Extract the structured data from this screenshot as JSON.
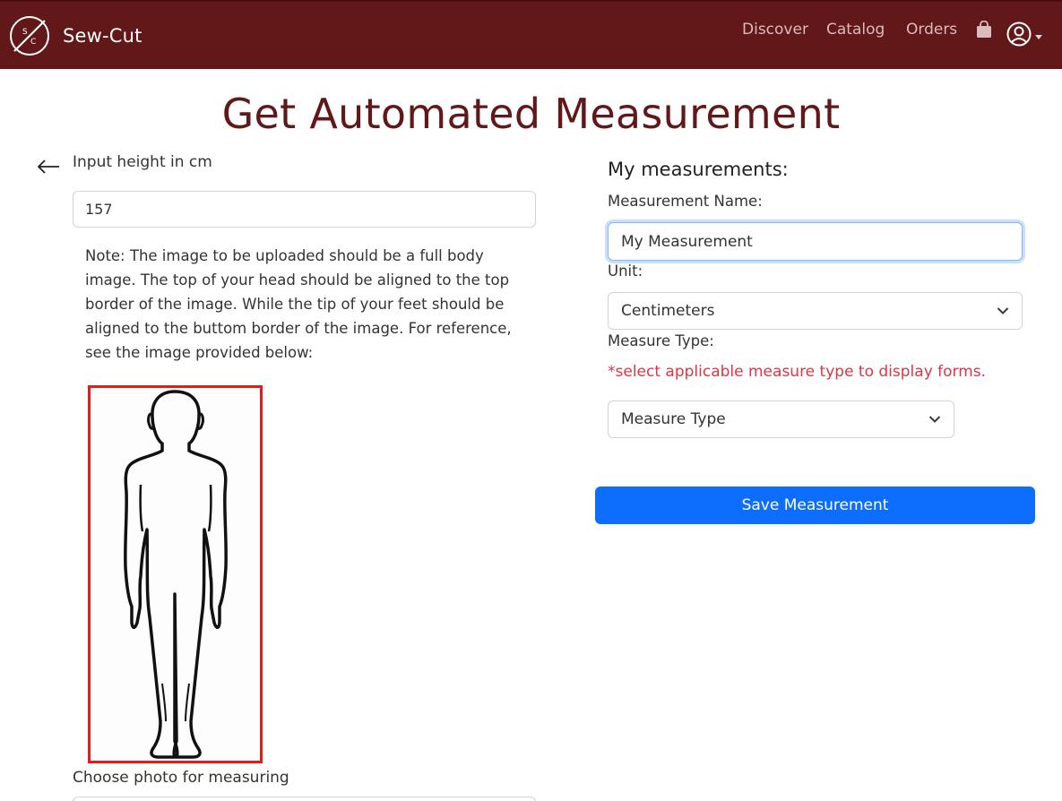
{
  "navbar": {
    "logo_letters": "S C",
    "brand": "Sew-Cut",
    "links": [
      "Discover",
      "Catalog",
      "Orders"
    ],
    "icons": [
      "bag-icon",
      "user-circle-icon",
      "caret-down-icon"
    ],
    "color": "#621818"
  },
  "page": {
    "title": "Get Automated Measurement"
  },
  "left": {
    "height_label": "Input height in cm",
    "height_value": "157",
    "note": "Note: The image to be uploaded should be a full body image. The top of your head should be aligned to the top border of the image. While the tip of your feet should be aligned to the buttom border of the image. For reference, see the image provided below:",
    "photo_label": "Choose photo for measuring"
  },
  "right": {
    "title": "My measurements:",
    "name_label": "Measurement Name:",
    "name_value": "My Measurement",
    "unit_label": "Unit:",
    "unit_value": "Centimeters",
    "type_label": "Measure Type:",
    "type_hint": "*select applicable measure type to display forms.",
    "type_value": "Measure Type",
    "save_label": "Save Measurement"
  },
  "colors": {
    "accent": "#0d6efd",
    "danger": "#dc3545",
    "title": "#621818"
  }
}
